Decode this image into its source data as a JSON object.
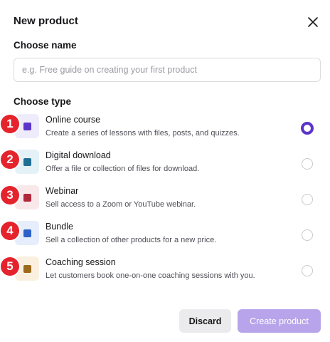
{
  "dialog": {
    "title": "New product",
    "close_icon": "close-icon"
  },
  "name_section": {
    "label": "Choose name",
    "placeholder": "e.g. Free guide on creating your first product",
    "value": ""
  },
  "type_section": {
    "label": "Choose type",
    "selected": "Online course",
    "items": [
      {
        "badge": "1",
        "title": "Online course",
        "description": "Create a series of lessons with files, posts, and quizzes.",
        "icon": "course-icon",
        "icon_bg": "#eeebfa",
        "icon_color": "#5b34c9",
        "checked": true
      },
      {
        "badge": "2",
        "title": "Digital download",
        "description": "Offer a file or collection of files for download.",
        "icon": "download-icon",
        "icon_bg": "#e4f1f6",
        "icon_color": "#1f6f95",
        "checked": false
      },
      {
        "badge": "3",
        "title": "Webinar",
        "description": "Sell access to a Zoom or YouTube webinar.",
        "icon": "webinar-icon",
        "icon_bg": "#f8e8ea",
        "icon_color": "#b0283a",
        "checked": false
      },
      {
        "badge": "4",
        "title": "Bundle",
        "description": "Sell a collection of other products for a new price.",
        "icon": "bundle-icon",
        "icon_bg": "#e5eefa",
        "icon_color": "#2d62c9",
        "checked": false
      },
      {
        "badge": "5",
        "title": "Coaching session",
        "description": "Let customers book one-on-one coaching sessions with you.",
        "icon": "coaching-icon",
        "icon_bg": "#fbf0df",
        "icon_color": "#9c6a1c",
        "checked": false
      }
    ]
  },
  "footer": {
    "discard_label": "Discard",
    "create_label": "Create product"
  },
  "colors": {
    "accent": "#5b34c9",
    "create_disabled": "#b7a4ea",
    "badge": "#e5232d"
  }
}
